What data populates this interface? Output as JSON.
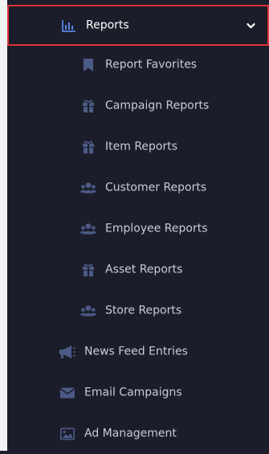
{
  "menu": {
    "reports": {
      "label": "Reports",
      "icon": "bar-chart-icon"
    },
    "submenu": [
      {
        "label": "Report Favorites",
        "icon": "bookmark-icon"
      },
      {
        "label": "Campaign Reports",
        "icon": "gift-icon"
      },
      {
        "label": "Item Reports",
        "icon": "gift-icon"
      },
      {
        "label": "Customer Reports",
        "icon": "users-icon"
      },
      {
        "label": "Employee Reports",
        "icon": "users-icon"
      },
      {
        "label": "Asset Reports",
        "icon": "gift-icon"
      },
      {
        "label": "Store Reports",
        "icon": "users-icon"
      }
    ],
    "news_feed": {
      "label": "News Feed Entries",
      "icon": "megaphone-icon"
    },
    "email_campaigns": {
      "label": "Email Campaigns",
      "icon": "envelope-icon"
    },
    "ad_management": {
      "label": "Ad Management",
      "icon": "image-icon"
    }
  },
  "colors": {
    "sidebar_bg": "#1b1d2a",
    "active_border": "#e0333b",
    "accent_blue": "#5a86e6",
    "icon_muted": "#4c5a86",
    "text": "#c8cbdc"
  }
}
